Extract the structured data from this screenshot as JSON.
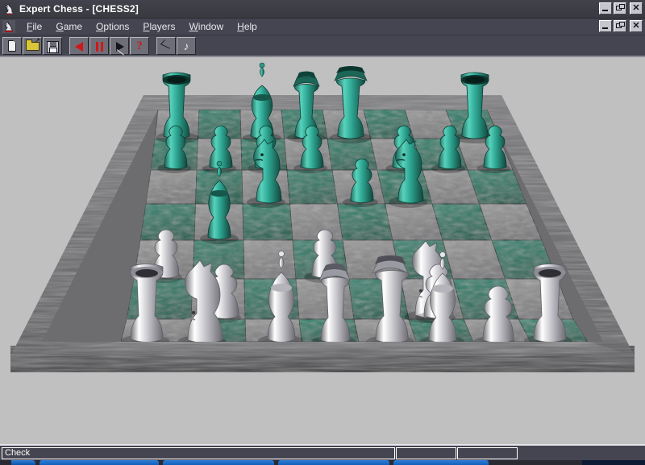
{
  "window": {
    "title": "Expert Chess - [CHESS2]",
    "icon": "chess-knight-icon",
    "controls": [
      {
        "name": "minimize",
        "glyph": "_"
      },
      {
        "name": "restore",
        "glyph": "❐"
      },
      {
        "name": "close",
        "glyph": "✕"
      }
    ]
  },
  "mdi": {
    "icon": "chess-knight-document-icon",
    "controls": [
      {
        "name": "minimize",
        "glyph": "_"
      },
      {
        "name": "restore",
        "glyph": "❐"
      },
      {
        "name": "close",
        "glyph": "✕"
      }
    ]
  },
  "menu": {
    "items": [
      {
        "label": "File",
        "accel": "F"
      },
      {
        "label": "Game",
        "accel": "G"
      },
      {
        "label": "Options",
        "accel": "O"
      },
      {
        "label": "Players",
        "accel": "P"
      },
      {
        "label": "Window",
        "accel": "W"
      },
      {
        "label": "Help",
        "accel": "H"
      }
    ]
  },
  "toolbar": {
    "buttons": [
      {
        "name": "new-game-button",
        "icon": "document-icon",
        "tooltip": "New"
      },
      {
        "name": "open-button",
        "icon": "open-folder-icon",
        "tooltip": "Open"
      },
      {
        "name": "save-button",
        "icon": "floppy-disk-icon",
        "tooltip": "Save"
      },
      {
        "name": "take-back-button",
        "icon": "triangle-left-icon",
        "tooltip": "Take Back"
      },
      {
        "name": "pause-button",
        "icon": "pause-icon",
        "tooltip": "Pause"
      },
      {
        "name": "play-button",
        "icon": "triangle-right-icon",
        "tooltip": "Play"
      },
      {
        "name": "help-button",
        "icon": "question-mark-icon",
        "tooltip": "Help"
      },
      {
        "name": "hint-button",
        "icon": "move-arrow-icon",
        "tooltip": "Hint"
      },
      {
        "name": "sound-button",
        "icon": "music-note-icon",
        "tooltip": "Sound"
      }
    ]
  },
  "status": {
    "message": "Check",
    "panel2": "",
    "panel3": ""
  },
  "colors": {
    "desktop": "#c0c0c0",
    "titlebar": "#3c3c44",
    "menubar": "#454551",
    "toolbar": "#454551",
    "statusbar": "#454551",
    "board_dark_square": "#2d7a68",
    "board_light_square": "#8e8e8e",
    "board_frame": "#6e6e70",
    "piece_black": "#35a392",
    "piece_white": "#d8d8dc",
    "accent_red": "#d01818",
    "taskbar_blue": "#1060bc"
  },
  "board": {
    "name": "chess-board",
    "perspective": "3d-tilted",
    "files": [
      "a",
      "b",
      "c",
      "d",
      "e",
      "f",
      "g",
      "h"
    ],
    "ranks": [
      8,
      7,
      6,
      5,
      4,
      3,
      2,
      1
    ],
    "pieces": [
      {
        "square": "a8",
        "color": "black",
        "type": "rook"
      },
      {
        "square": "c8",
        "color": "black",
        "type": "bishop"
      },
      {
        "square": "d8",
        "color": "black",
        "type": "king"
      },
      {
        "square": "e8",
        "color": "black",
        "type": "queen"
      },
      {
        "square": "h8",
        "color": "black",
        "type": "rook"
      },
      {
        "square": "a7",
        "color": "black",
        "type": "pawn"
      },
      {
        "square": "b7",
        "color": "black",
        "type": "pawn"
      },
      {
        "square": "c7",
        "color": "black",
        "type": "pawn"
      },
      {
        "square": "d7",
        "color": "black",
        "type": "pawn"
      },
      {
        "square": "f7",
        "color": "black",
        "type": "pawn"
      },
      {
        "square": "g7",
        "color": "black",
        "type": "pawn"
      },
      {
        "square": "h7",
        "color": "black",
        "type": "pawn"
      },
      {
        "square": "c6",
        "color": "black",
        "type": "knight"
      },
      {
        "square": "e6",
        "color": "black",
        "type": "pawn"
      },
      {
        "square": "f6",
        "color": "black",
        "type": "knight"
      },
      {
        "square": "b5",
        "color": "black",
        "type": "bishop"
      },
      {
        "square": "a4",
        "color": "white",
        "type": "pawn"
      },
      {
        "square": "d4",
        "color": "white",
        "type": "pawn"
      },
      {
        "square": "f4",
        "color": "white",
        "type": "knight"
      },
      {
        "square": "b3",
        "color": "white",
        "type": "pawn"
      },
      {
        "square": "f3",
        "color": "white",
        "type": "pawn"
      },
      {
        "square": "c2",
        "color": "white",
        "type": "pawn"
      },
      {
        "square": "d2",
        "color": "white",
        "type": "pawn"
      },
      {
        "square": "e2",
        "color": "white",
        "type": "pawn"
      },
      {
        "square": "g2",
        "color": "white",
        "type": "pawn"
      },
      {
        "square": "a1",
        "color": "white",
        "type": "rook"
      },
      {
        "square": "b1",
        "color": "white",
        "type": "knight"
      },
      {
        "square": "c1",
        "color": "white",
        "type": "bishop"
      },
      {
        "square": "d1",
        "color": "white",
        "type": "king"
      },
      {
        "square": "e1",
        "color": "white",
        "type": "queen"
      },
      {
        "square": "f1",
        "color": "white",
        "type": "bishop"
      },
      {
        "square": "h1",
        "color": "white",
        "type": "rook"
      }
    ]
  },
  "taskbar": {
    "start_label": "",
    "tasks": [
      "",
      "",
      "",
      ""
    ]
  }
}
